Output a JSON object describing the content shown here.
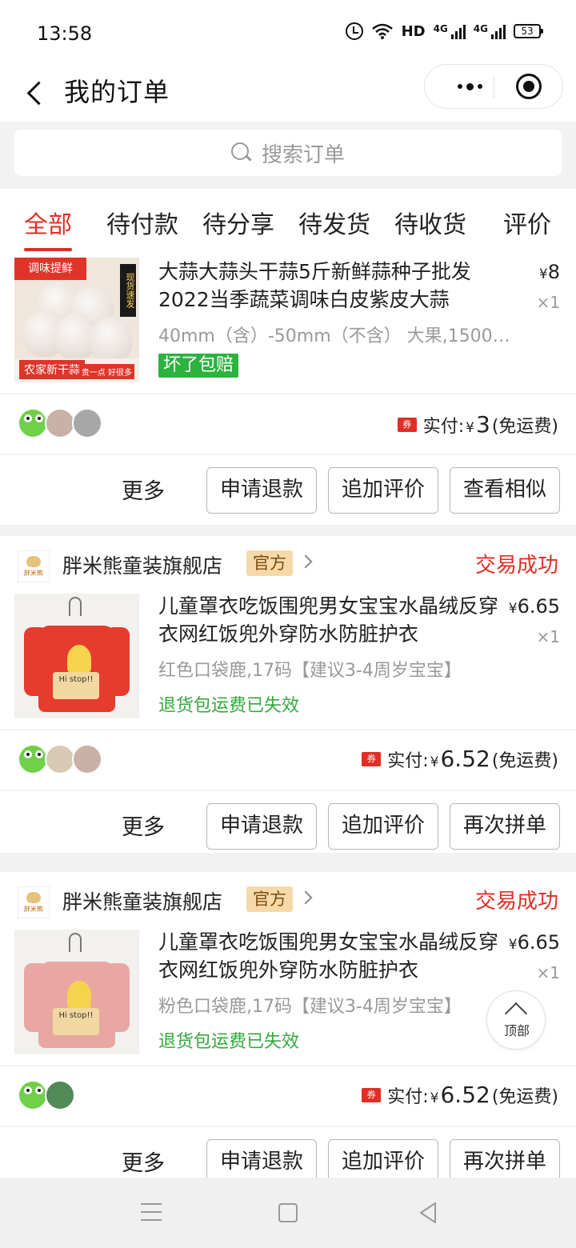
{
  "status_bar": {
    "time": "13:58",
    "network": "HD",
    "signal1": "4G",
    "signal2": "4G",
    "battery": "53"
  },
  "header": {
    "title": "我的订单"
  },
  "search": {
    "placeholder": "搜索订单"
  },
  "tabs": [
    {
      "label": "全部",
      "active": true
    },
    {
      "label": "待付款"
    },
    {
      "label": "待分享"
    },
    {
      "label": "待发货"
    },
    {
      "label": "待收货"
    },
    {
      "label": "评价"
    }
  ],
  "orders": [
    {
      "product": {
        "name": "大蒜大蒜头干蒜5斤新鲜蒜种子批发2022当季蔬菜调味白皮紫皮大蒜",
        "price": "8",
        "qty": "×1",
        "spec": "40mm（含）-50mm（不含） 大果,1500…",
        "tag": "坏了包赔",
        "image": {
          "top_label": "调味提鲜",
          "side_label": "现货速发",
          "bottom_label": "农家新干蒜",
          "corner_label": "贵一点 好很多"
        }
      },
      "paid_label": "实付:",
      "coupon": "券",
      "paid_currency": "¥",
      "paid_amount": "3",
      "shipping": "(免运费)",
      "actions": {
        "more": "更多",
        "b1": "申请退款",
        "b2": "追加评价",
        "b3": "查看相似"
      }
    },
    {
      "shop": {
        "name": "胖米熊童装旗舰店",
        "badge": "官方",
        "logo_text": "胖米熊"
      },
      "status": "交易成功",
      "product": {
        "name": "儿童罩衣吃饭围兜男女宝宝水晶绒反穿衣网红饭兜外穿防水防脏护衣",
        "price_currency": "¥",
        "price": "6.65",
        "qty": "×1",
        "spec": "红色口袋鹿,17码【建议3-4周岁宝宝】",
        "notice": "退货包运费已失效",
        "image": {
          "color": "#e63b2e",
          "pocket_text": "Hi stop!!"
        }
      },
      "paid_label": "实付:",
      "coupon": "券",
      "paid_currency": "¥",
      "paid_amount": "6.52",
      "shipping": "(免运费)",
      "actions": {
        "more": "更多",
        "b1": "申请退款",
        "b2": "追加评价",
        "b3": "再次拼单"
      }
    },
    {
      "shop": {
        "name": "胖米熊童装旗舰店",
        "badge": "官方",
        "logo_text": "胖米熊"
      },
      "status": "交易成功",
      "product": {
        "name": "儿童罩衣吃饭围兜男女宝宝水晶绒反穿衣网红饭兜外穿防水防脏护衣",
        "price_currency": "¥",
        "price": "6.65",
        "qty": "×1",
        "spec": "粉色口袋鹿,17码【建议3-4周岁宝宝】",
        "notice": "退货包运费已失效",
        "image": {
          "color": "#e9a7a4",
          "pocket_text": "Hi stop!!"
        }
      },
      "paid_label": "实付:",
      "coupon": "券",
      "paid_currency": "¥",
      "paid_amount": "6.52",
      "shipping": "(免运费)",
      "actions": {
        "more": "更多",
        "b1": "申请退款",
        "b2": "追加评价",
        "b3": "再次拼单"
      }
    }
  ],
  "back_to_top": "顶部",
  "colors": {
    "accent": "#e02e24",
    "green": "#2cb23f",
    "badge": "#f6d9a8"
  }
}
